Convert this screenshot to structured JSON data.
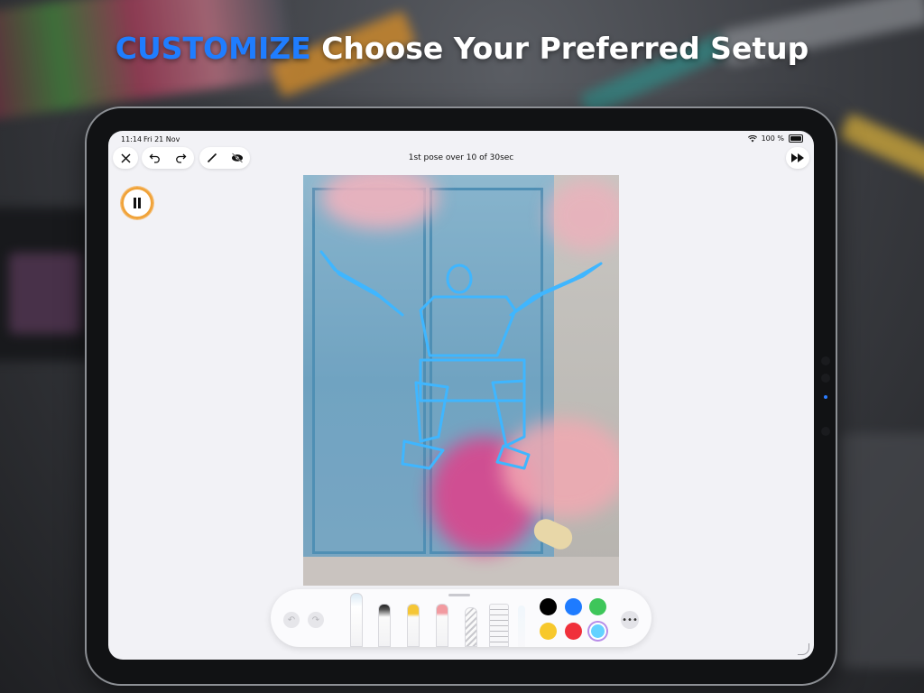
{
  "headline": {
    "accent": "CUSTOMIZE",
    "rest": "Choose Your Preferred Setup"
  },
  "status_bar": {
    "time": "11:14",
    "date": "Fri 21 Nov",
    "battery": "100 %"
  },
  "toolbar": {
    "title": "1st pose over 10 of 30sec",
    "icons": [
      "close-icon",
      "undo-icon",
      "redo-icon",
      "pencil-icon",
      "hide-eye-icon",
      "fast-forward-icon"
    ]
  },
  "timer": {
    "state": "paused",
    "icon": "pause-icon"
  },
  "drawing_tools": {
    "tools": [
      "pen",
      "fineliner",
      "marker",
      "eraser",
      "lasso",
      "ruler"
    ],
    "colors": [
      "#000000",
      "#1e7bff",
      "#3ec65a",
      "#f7c82c",
      "#f0303b",
      "#64d2ff"
    ],
    "selected_color": "#64d2ff"
  },
  "colors": {
    "accent": "#1f7dff",
    "timer_ring": "#f0a33a",
    "sketch": "#3fb6ff"
  }
}
